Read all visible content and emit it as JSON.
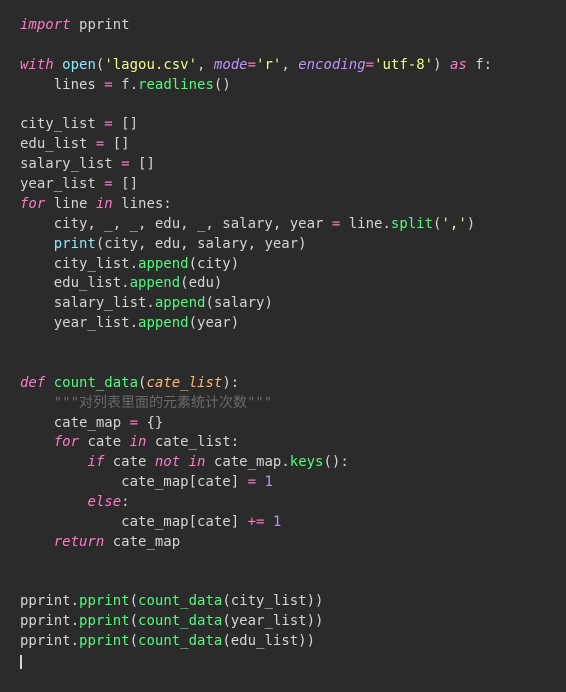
{
  "chart_data": {
    "type": "table",
    "title": "Python source code",
    "language": "python",
    "lines": [
      {
        "n": 1,
        "tokens": [
          {
            "t": "import",
            "c": "kw"
          },
          {
            "t": " ",
            "c": "punct"
          },
          {
            "t": "pprint",
            "c": "ident"
          }
        ]
      },
      {
        "n": 2,
        "tokens": []
      },
      {
        "n": 3,
        "tokens": [
          {
            "t": "with",
            "c": "kw"
          },
          {
            "t": " ",
            "c": "punct"
          },
          {
            "t": "open",
            "c": "builtin"
          },
          {
            "t": "(",
            "c": "punct"
          },
          {
            "t": "'lagou.csv'",
            "c": "str"
          },
          {
            "t": ", ",
            "c": "punct"
          },
          {
            "t": "mode",
            "c": "kwarg"
          },
          {
            "t": "=",
            "c": "op"
          },
          {
            "t": "'r'",
            "c": "str"
          },
          {
            "t": ", ",
            "c": "punct"
          },
          {
            "t": "encoding",
            "c": "kwarg"
          },
          {
            "t": "=",
            "c": "op"
          },
          {
            "t": "'utf-8'",
            "c": "str"
          },
          {
            "t": ") ",
            "c": "punct"
          },
          {
            "t": "as",
            "c": "kw"
          },
          {
            "t": " f:",
            "c": "punct"
          }
        ]
      },
      {
        "n": 4,
        "tokens": [
          {
            "t": "    lines ",
            "c": "ident"
          },
          {
            "t": "=",
            "c": "op"
          },
          {
            "t": " f.",
            "c": "ident"
          },
          {
            "t": "readlines",
            "c": "fn"
          },
          {
            "t": "()",
            "c": "punct"
          }
        ]
      },
      {
        "n": 5,
        "tokens": []
      },
      {
        "n": 6,
        "tokens": [
          {
            "t": "city_list ",
            "c": "ident"
          },
          {
            "t": "=",
            "c": "op"
          },
          {
            "t": " []",
            "c": "punct"
          }
        ]
      },
      {
        "n": 7,
        "tokens": [
          {
            "t": "edu_list ",
            "c": "ident"
          },
          {
            "t": "=",
            "c": "op"
          },
          {
            "t": " []",
            "c": "punct"
          }
        ]
      },
      {
        "n": 8,
        "tokens": [
          {
            "t": "salary_list ",
            "c": "ident"
          },
          {
            "t": "=",
            "c": "op"
          },
          {
            "t": " []",
            "c": "punct"
          }
        ]
      },
      {
        "n": 9,
        "tokens": [
          {
            "t": "year_list ",
            "c": "ident"
          },
          {
            "t": "=",
            "c": "op"
          },
          {
            "t": " []",
            "c": "punct"
          }
        ]
      },
      {
        "n": 10,
        "tokens": [
          {
            "t": "for",
            "c": "kw"
          },
          {
            "t": " line ",
            "c": "ident"
          },
          {
            "t": "in",
            "c": "kw"
          },
          {
            "t": " lines:",
            "c": "ident"
          }
        ]
      },
      {
        "n": 11,
        "tokens": [
          {
            "t": "    city, _, _, edu, _, salary, year ",
            "c": "ident"
          },
          {
            "t": "=",
            "c": "op"
          },
          {
            "t": " line.",
            "c": "ident"
          },
          {
            "t": "split",
            "c": "fn"
          },
          {
            "t": "(",
            "c": "punct"
          },
          {
            "t": "','",
            "c": "str"
          },
          {
            "t": ")",
            "c": "punct"
          }
        ]
      },
      {
        "n": 12,
        "tokens": [
          {
            "t": "    ",
            "c": "punct"
          },
          {
            "t": "print",
            "c": "builtin"
          },
          {
            "t": "(city, edu, salary, year)",
            "c": "ident"
          }
        ]
      },
      {
        "n": 13,
        "tokens": [
          {
            "t": "    city_list.",
            "c": "ident"
          },
          {
            "t": "append",
            "c": "fn"
          },
          {
            "t": "(city)",
            "c": "ident"
          }
        ]
      },
      {
        "n": 14,
        "tokens": [
          {
            "t": "    edu_list.",
            "c": "ident"
          },
          {
            "t": "append",
            "c": "fn"
          },
          {
            "t": "(edu)",
            "c": "ident"
          }
        ]
      },
      {
        "n": 15,
        "tokens": [
          {
            "t": "    salary_list.",
            "c": "ident"
          },
          {
            "t": "append",
            "c": "fn"
          },
          {
            "t": "(salary)",
            "c": "ident"
          }
        ]
      },
      {
        "n": 16,
        "tokens": [
          {
            "t": "    year_list.",
            "c": "ident"
          },
          {
            "t": "append",
            "c": "fn"
          },
          {
            "t": "(year)",
            "c": "ident"
          }
        ]
      },
      {
        "n": 17,
        "tokens": []
      },
      {
        "n": 18,
        "tokens": []
      },
      {
        "n": 19,
        "tokens": [
          {
            "t": "def",
            "c": "kw-def"
          },
          {
            "t": " ",
            "c": "punct"
          },
          {
            "t": "count_data",
            "c": "funcname"
          },
          {
            "t": "(",
            "c": "punct"
          },
          {
            "t": "cate_list",
            "c": "param"
          },
          {
            "t": "):",
            "c": "punct"
          }
        ]
      },
      {
        "n": 20,
        "tokens": [
          {
            "t": "    ",
            "c": "punct"
          },
          {
            "t": "\"\"\"对列表里面的元素统计次数\"\"\"",
            "c": "comment"
          }
        ]
      },
      {
        "n": 21,
        "tokens": [
          {
            "t": "    cate_map ",
            "c": "ident"
          },
          {
            "t": "=",
            "c": "op"
          },
          {
            "t": " {}",
            "c": "punct"
          }
        ]
      },
      {
        "n": 22,
        "tokens": [
          {
            "t": "    ",
            "c": "punct"
          },
          {
            "t": "for",
            "c": "kw"
          },
          {
            "t": " cate ",
            "c": "ident"
          },
          {
            "t": "in",
            "c": "kw"
          },
          {
            "t": " cate_list:",
            "c": "ident"
          }
        ]
      },
      {
        "n": 23,
        "tokens": [
          {
            "t": "        ",
            "c": "punct"
          },
          {
            "t": "if",
            "c": "kw"
          },
          {
            "t": " cate ",
            "c": "ident"
          },
          {
            "t": "not",
            "c": "kw"
          },
          {
            "t": " ",
            "c": "punct"
          },
          {
            "t": "in",
            "c": "kw"
          },
          {
            "t": " cate_map.",
            "c": "ident"
          },
          {
            "t": "keys",
            "c": "fn"
          },
          {
            "t": "():",
            "c": "punct"
          }
        ]
      },
      {
        "n": 24,
        "tokens": [
          {
            "t": "            cate_map[cate] ",
            "c": "ident"
          },
          {
            "t": "=",
            "c": "op"
          },
          {
            "t": " ",
            "c": "punct"
          },
          {
            "t": "1",
            "c": "num"
          }
        ]
      },
      {
        "n": 25,
        "tokens": [
          {
            "t": "        ",
            "c": "punct"
          },
          {
            "t": "else",
            "c": "kw"
          },
          {
            "t": ":",
            "c": "punct"
          }
        ]
      },
      {
        "n": 26,
        "tokens": [
          {
            "t": "            cate_map[cate] ",
            "c": "ident"
          },
          {
            "t": "+=",
            "c": "op"
          },
          {
            "t": " ",
            "c": "punct"
          },
          {
            "t": "1",
            "c": "num"
          }
        ]
      },
      {
        "n": 27,
        "tokens": [
          {
            "t": "    ",
            "c": "punct"
          },
          {
            "t": "return",
            "c": "kw"
          },
          {
            "t": " cate_map",
            "c": "ident"
          }
        ]
      },
      {
        "n": 28,
        "tokens": []
      },
      {
        "n": 29,
        "tokens": []
      },
      {
        "n": 30,
        "tokens": [
          {
            "t": "pprint.",
            "c": "ident"
          },
          {
            "t": "pprint",
            "c": "fn"
          },
          {
            "t": "(",
            "c": "punct"
          },
          {
            "t": "count_data",
            "c": "fn"
          },
          {
            "t": "(city_list))",
            "c": "ident"
          }
        ]
      },
      {
        "n": 31,
        "tokens": [
          {
            "t": "pprint.",
            "c": "ident"
          },
          {
            "t": "pprint",
            "c": "fn"
          },
          {
            "t": "(",
            "c": "punct"
          },
          {
            "t": "count_data",
            "c": "fn"
          },
          {
            "t": "(year_list))",
            "c": "ident"
          }
        ]
      },
      {
        "n": 32,
        "tokens": [
          {
            "t": "pprint.",
            "c": "ident"
          },
          {
            "t": "pprint",
            "c": "fn"
          },
          {
            "t": "(",
            "c": "punct"
          },
          {
            "t": "count_data",
            "c": "fn"
          },
          {
            "t": "(edu_list))",
            "c": "ident"
          }
        ]
      },
      {
        "n": 33,
        "tokens": [],
        "cursor": true
      }
    ]
  }
}
